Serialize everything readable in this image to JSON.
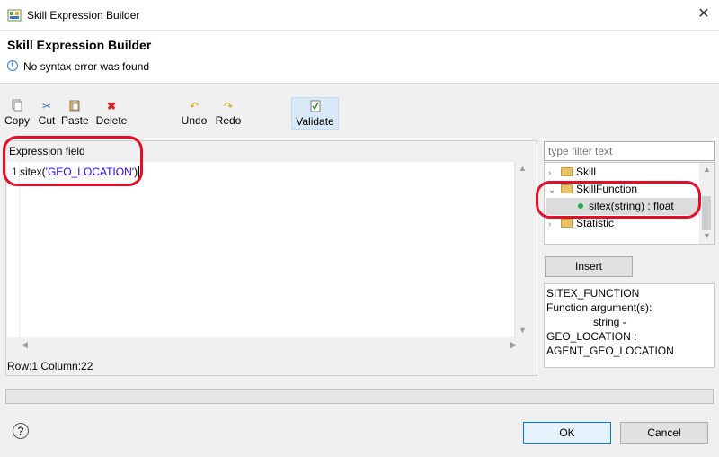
{
  "window": {
    "title": "Skill Expression Builder",
    "close_glyph": "✕"
  },
  "header": {
    "title": "Skill Expression Builder",
    "message": "No syntax error was found"
  },
  "toolbar": {
    "copy": "Copy",
    "cut": "Cut",
    "paste": "Paste",
    "delete": "Delete",
    "undo": "Undo",
    "redo": "Redo",
    "validate": "Validate"
  },
  "expression": {
    "label": "Expression field",
    "line_number": "1",
    "code_prefix": "sitex(",
    "code_string": "'GEO_LOCATION'",
    "code_suffix": ")",
    "status": "Row:1 Column:22"
  },
  "filter": {
    "placeholder": "type filter text"
  },
  "tree": {
    "items": [
      {
        "label": "Skill",
        "expanded": false
      },
      {
        "label": "SkillFunction",
        "expanded": true
      },
      {
        "label": "sitex(string) : float",
        "selected": true
      },
      {
        "label": "Statistic",
        "expanded": false
      }
    ]
  },
  "insert_label": "Insert",
  "description": {
    "line1": "SITEX_FUNCTION",
    "line2": "Function argument(s):",
    "line3": "string -",
    "line4": "GEO_LOCATION :",
    "line5": "AGENT_GEO_LOCATION"
  },
  "buttons": {
    "ok": "OK",
    "cancel": "Cancel",
    "help": "?"
  },
  "colors": {
    "annotation_red": "#e0102a",
    "string_blue": "#2a00ff",
    "ok_border": "#0078d7"
  }
}
